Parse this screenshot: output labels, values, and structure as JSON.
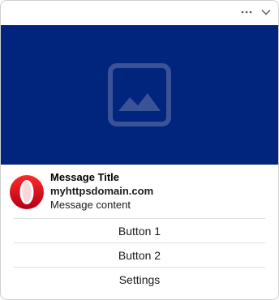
{
  "header": {
    "more_icon": "more-horizontal-icon",
    "collapse_icon": "chevron-down-icon"
  },
  "hero": {
    "background": "#01257d",
    "icon": "image-placeholder-icon"
  },
  "notification": {
    "app_icon": "opera-logo",
    "title": "Message Title",
    "domain": "myhttpsdomain.com",
    "message": "Message content"
  },
  "actions": [
    {
      "label": "Button 1"
    },
    {
      "label": "Button 2"
    },
    {
      "label": "Settings"
    }
  ],
  "colors": {
    "accent_red": "#e0111b",
    "hero_blue": "#01257d"
  }
}
